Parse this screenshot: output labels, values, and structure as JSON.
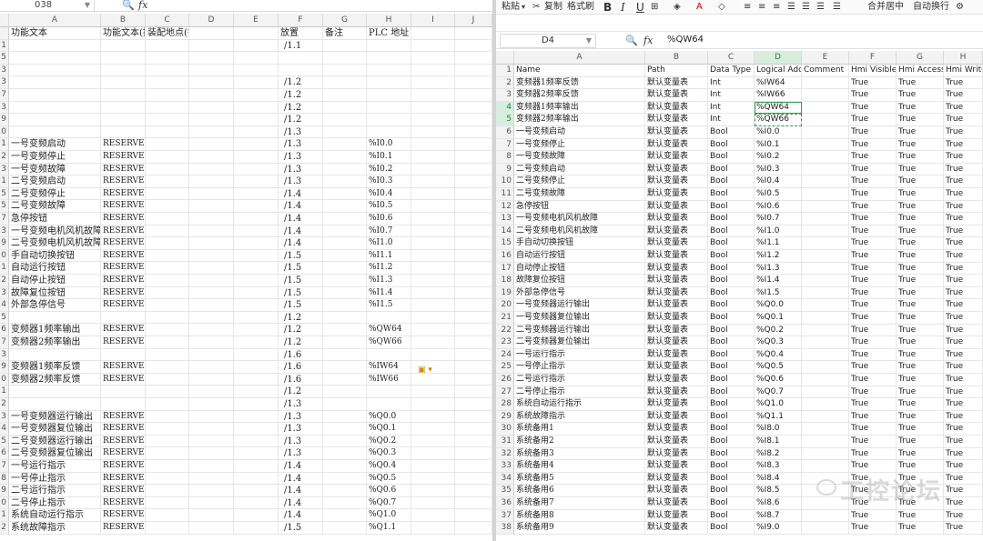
{
  "left": {
    "name_box": "038",
    "formula_icon": "fx",
    "zoom_icon": "magnifier-icon",
    "columns": [
      "A",
      "B",
      "C",
      "D",
      "E",
      "F",
      "G",
      "H",
      "I",
      "J"
    ],
    "header_row": [
      "功能文本",
      "功能文本(技术参数",
      "装配地点(铭牌文本",
      "",
      "",
      "放置",
      "备注",
      "PLC 地址",
      "",
      ""
    ],
    "rows": [
      {
        "num": "1",
        "a": "",
        "b": "",
        "f": "/1.1",
        "h": ""
      },
      {
        "num": "5",
        "a": "",
        "b": "",
        "f": "",
        "h": ""
      },
      {
        "num": "3",
        "a": "",
        "b": "",
        "f": "",
        "h": ""
      },
      {
        "num": "3",
        "a": "",
        "b": "",
        "f": "/1.2",
        "h": ""
      },
      {
        "num": "7",
        "a": "",
        "b": "",
        "f": "/1.2",
        "h": ""
      },
      {
        "num": "3",
        "a": "",
        "b": "",
        "f": "/1.2",
        "h": ""
      },
      {
        "num": "9",
        "a": "",
        "b": "",
        "f": "/1.2",
        "h": ""
      },
      {
        "num": "0",
        "a": "",
        "b": "",
        "f": "/1.3",
        "h": ""
      },
      {
        "num": "1",
        "a": "一号变频启动",
        "b": "RESERVE",
        "f": "/1.3",
        "h": "%I0.0"
      },
      {
        "num": "2",
        "a": "一号变频停止",
        "b": "RESERVE",
        "f": "/1.3",
        "h": "%I0.1"
      },
      {
        "num": "3",
        "a": "一号变频故障",
        "b": "RESERVE",
        "f": "/1.3",
        "h": "%I0.2"
      },
      {
        "num": "1",
        "a": "二号变频启动",
        "b": "RESERVE",
        "f": "/1.3",
        "h": "%I0.3"
      },
      {
        "num": "5",
        "a": "二号变频停止",
        "b": "RESERVE",
        "f": "/1.4",
        "h": "%I0.4"
      },
      {
        "num": "5",
        "a": "二号变频故障",
        "b": "RESERVE",
        "f": "/1.4",
        "h": "%I0.5"
      },
      {
        "num": "7",
        "a": "急停按钮",
        "b": "RESERVE",
        "f": "/1.4",
        "h": "%I0.6"
      },
      {
        "num": "3",
        "a": "一号变频电机风机故障",
        "b": "RESERVE",
        "f": "/1.4",
        "h": "%I0.7"
      },
      {
        "num": "9",
        "a": "二号变频电机风机故障",
        "b": "RESERVE",
        "f": "/1.4",
        "h": "%I1.0"
      },
      {
        "num": "0",
        "a": "手自动切换按钮",
        "b": "RESERVE",
        "f": "/1.5",
        "h": "%I1.1"
      },
      {
        "num": "1",
        "a": "自动运行按钮",
        "b": "RESERVE",
        "f": "/1.5",
        "h": "%I1.2"
      },
      {
        "num": "2",
        "a": "自动停止按钮",
        "b": "RESERVE",
        "f": "/1.5",
        "h": "%I1.3"
      },
      {
        "num": "3",
        "a": "故障复位按钮",
        "b": "RESERVE",
        "f": "/1.5",
        "h": "%I1.4"
      },
      {
        "num": "4",
        "a": "外部急停信号",
        "b": "RESERVE",
        "f": "/1.5",
        "h": "%I1.5"
      },
      {
        "num": "5",
        "a": "",
        "b": "",
        "f": "/1.2",
        "h": ""
      },
      {
        "num": "6",
        "a": "变频器1频率输出",
        "b": "RESERVE",
        "f": "/1.2",
        "h": "%QW64"
      },
      {
        "num": "7",
        "a": "变频器2频率输出",
        "b": "RESERVE",
        "f": "/1.2",
        "h": "%QW66"
      },
      {
        "num": "3",
        "a": "",
        "b": "",
        "f": "/1.6",
        "h": ""
      },
      {
        "num": "9",
        "a": "变频器1频率反馈",
        "b": "RESERVE",
        "f": "/1.6",
        "h": "%IW64"
      },
      {
        "num": "0",
        "a": "变频器2频率反馈",
        "b": "RESERVE",
        "f": "/1.6",
        "h": "%IW66"
      },
      {
        "num": "1",
        "a": "",
        "b": "",
        "f": "/1.2",
        "h": ""
      },
      {
        "num": "2",
        "a": "",
        "b": "",
        "f": "/1.3",
        "h": ""
      },
      {
        "num": "3",
        "a": "一号变频器运行输出",
        "b": "RESERVE",
        "f": "/1.3",
        "h": "%Q0.0"
      },
      {
        "num": "4",
        "a": "一号变频器复位输出",
        "b": "RESERVE",
        "f": "/1.3",
        "h": "%Q0.1"
      },
      {
        "num": "5",
        "a": "二号变频器运行输出",
        "b": "RESERVE",
        "f": "/1.3",
        "h": "%Q0.2"
      },
      {
        "num": "6",
        "a": "二号变频器复位输出",
        "b": "RESERVE",
        "f": "/1.3",
        "h": "%Q0.3"
      },
      {
        "num": "7",
        "a": "一号运行指示",
        "b": "RESERVE",
        "f": "/1.4",
        "h": "%Q0.4"
      },
      {
        "num": "8",
        "a": "一号停止指示",
        "b": "RESERVE",
        "f": "/1.4",
        "h": "%Q0.5"
      },
      {
        "num": "9",
        "a": "二号运行指示",
        "b": "RESERVE",
        "f": "/1.4",
        "h": "%Q0.6"
      },
      {
        "num": "0",
        "a": "二号停止指示",
        "b": "RESERVE",
        "f": "/1.4",
        "h": "%Q0.7"
      },
      {
        "num": "1",
        "a": "系统自动运行指示",
        "b": "RESERVE",
        "f": "/1.4",
        "h": "%Q1.0"
      },
      {
        "num": "2",
        "a": "系统故障指示",
        "b": "RESERVE",
        "f": "/1.5",
        "h": "%Q1.1"
      }
    ]
  },
  "right": {
    "toolbar": {
      "paste": "粘贴",
      "copy": "复制",
      "format_painter": "格式刷",
      "bold": "B",
      "italic": "I",
      "underline": "U",
      "merge_center": "合并居中",
      "wrap": "自动换行"
    },
    "name_box": "D4",
    "formula_icon": "fx",
    "formula_value": "%QW64",
    "columns": [
      "A",
      "B",
      "C",
      "D",
      "E",
      "F",
      "G",
      "H"
    ],
    "header": [
      "Name",
      "Path",
      "Data Type",
      "Logical Addr",
      "Comment",
      "Hmi Visible",
      "Hmi Accessi",
      "Hmi Write"
    ],
    "rows": [
      {
        "num": "2",
        "name": "变频器1频率反馈",
        "path": "默认变量表",
        "type": "Int",
        "addr": "%IW64",
        "vis": "True",
        "acc": "True",
        "wr": "True"
      },
      {
        "num": "3",
        "name": "变频器2频率反馈",
        "path": "默认变量表",
        "type": "Int",
        "addr": "%IW66",
        "vis": "True",
        "acc": "True",
        "wr": "True"
      },
      {
        "num": "4",
        "name": "变频器1频率输出",
        "path": "默认变量表",
        "type": "Int",
        "addr": "%QW64",
        "vis": "True",
        "acc": "True",
        "wr": "True"
      },
      {
        "num": "5",
        "name": "变频器2频率输出",
        "path": "默认变量表",
        "type": "Int",
        "addr": "%QW66",
        "vis": "True",
        "acc": "True",
        "wr": "True"
      },
      {
        "num": "6",
        "name": "一号变频启动",
        "path": "默认变量表",
        "type": "Bool",
        "addr": "%I0.0",
        "vis": "True",
        "acc": "True",
        "wr": "True"
      },
      {
        "num": "7",
        "name": "一号变频停止",
        "path": "默认变量表",
        "type": "Bool",
        "addr": "%I0.1",
        "vis": "True",
        "acc": "True",
        "wr": "True"
      },
      {
        "num": "8",
        "name": "一号变频故障",
        "path": "默认变量表",
        "type": "Bool",
        "addr": "%I0.2",
        "vis": "True",
        "acc": "True",
        "wr": "True"
      },
      {
        "num": "9",
        "name": "二号变频启动",
        "path": "默认变量表",
        "type": "Bool",
        "addr": "%I0.3",
        "vis": "True",
        "acc": "True",
        "wr": "True"
      },
      {
        "num": "10",
        "name": "二号变频停止",
        "path": "默认变量表",
        "type": "Bool",
        "addr": "%I0.4",
        "vis": "True",
        "acc": "True",
        "wr": "True"
      },
      {
        "num": "11",
        "name": "二号变频故障",
        "path": "默认变量表",
        "type": "Bool",
        "addr": "%I0.5",
        "vis": "True",
        "acc": "True",
        "wr": "True"
      },
      {
        "num": "12",
        "name": "急停按钮",
        "path": "默认变量表",
        "type": "Bool",
        "addr": "%I0.6",
        "vis": "True",
        "acc": "True",
        "wr": "True"
      },
      {
        "num": "13",
        "name": "一号变频电机风机故障",
        "path": "默认变量表",
        "type": "Bool",
        "addr": "%I0.7",
        "vis": "True",
        "acc": "True",
        "wr": "True"
      },
      {
        "num": "14",
        "name": "二号变频电机风机故障",
        "path": "默认变量表",
        "type": "Bool",
        "addr": "%I1.0",
        "vis": "True",
        "acc": "True",
        "wr": "True"
      },
      {
        "num": "15",
        "name": "手自动切换按钮",
        "path": "默认变量表",
        "type": "Bool",
        "addr": "%I1.1",
        "vis": "True",
        "acc": "True",
        "wr": "True"
      },
      {
        "num": "16",
        "name": "自动运行按钮",
        "path": "默认变量表",
        "type": "Bool",
        "addr": "%I1.2",
        "vis": "True",
        "acc": "True",
        "wr": "True"
      },
      {
        "num": "17",
        "name": "自动停止按钮",
        "path": "默认变量表",
        "type": "Bool",
        "addr": "%I1.3",
        "vis": "True",
        "acc": "True",
        "wr": "True"
      },
      {
        "num": "18",
        "name": "故障复位按钮",
        "path": "默认变量表",
        "type": "Bool",
        "addr": "%I1.4",
        "vis": "True",
        "acc": "True",
        "wr": "True"
      },
      {
        "num": "19",
        "name": "外部急停信号",
        "path": "默认变量表",
        "type": "Bool",
        "addr": "%I1.5",
        "vis": "True",
        "acc": "True",
        "wr": "True"
      },
      {
        "num": "20",
        "name": "一号变频器运行输出",
        "path": "默认变量表",
        "type": "Bool",
        "addr": "%Q0.0",
        "vis": "True",
        "acc": "True",
        "wr": "True"
      },
      {
        "num": "21",
        "name": "一号变频器复位输出",
        "path": "默认变量表",
        "type": "Bool",
        "addr": "%Q0.1",
        "vis": "True",
        "acc": "True",
        "wr": "True"
      },
      {
        "num": "22",
        "name": "二号变频器运行输出",
        "path": "默认变量表",
        "type": "Bool",
        "addr": "%Q0.2",
        "vis": "True",
        "acc": "True",
        "wr": "True"
      },
      {
        "num": "23",
        "name": "二号变频器复位输出",
        "path": "默认变量表",
        "type": "Bool",
        "addr": "%Q0.3",
        "vis": "True",
        "acc": "True",
        "wr": "True"
      },
      {
        "num": "24",
        "name": "一号运行指示",
        "path": "默认变量表",
        "type": "Bool",
        "addr": "%Q0.4",
        "vis": "True",
        "acc": "True",
        "wr": "True"
      },
      {
        "num": "25",
        "name": "一号停止指示",
        "path": "默认变量表",
        "type": "Bool",
        "addr": "%Q0.5",
        "vis": "True",
        "acc": "True",
        "wr": "True"
      },
      {
        "num": "26",
        "name": "二号运行指示",
        "path": "默认变量表",
        "type": "Bool",
        "addr": "%Q0.6",
        "vis": "True",
        "acc": "True",
        "wr": "True"
      },
      {
        "num": "27",
        "name": "二号停止指示",
        "path": "默认变量表",
        "type": "Bool",
        "addr": "%Q0.7",
        "vis": "True",
        "acc": "True",
        "wr": "True"
      },
      {
        "num": "28",
        "name": "系统自动运行指示",
        "path": "默认变量表",
        "type": "Bool",
        "addr": "%Q1.0",
        "vis": "True",
        "acc": "True",
        "wr": "True"
      },
      {
        "num": "29",
        "name": "系统故障指示",
        "path": "默认变量表",
        "type": "Bool",
        "addr": "%Q1.1",
        "vis": "True",
        "acc": "True",
        "wr": "True"
      },
      {
        "num": "30",
        "name": "系统备用1",
        "path": "默认变量表",
        "type": "Bool",
        "addr": "%I8.0",
        "vis": "True",
        "acc": "True",
        "wr": "True"
      },
      {
        "num": "31",
        "name": "系统备用2",
        "path": "默认变量表",
        "type": "Bool",
        "addr": "%I8.1",
        "vis": "True",
        "acc": "True",
        "wr": "True"
      },
      {
        "num": "32",
        "name": "系统备用3",
        "path": "默认变量表",
        "type": "Bool",
        "addr": "%I8.2",
        "vis": "True",
        "acc": "True",
        "wr": "True"
      },
      {
        "num": "33",
        "name": "系统备用4",
        "path": "默认变量表",
        "type": "Bool",
        "addr": "%I8.3",
        "vis": "True",
        "acc": "True",
        "wr": "True"
      },
      {
        "num": "34",
        "name": "系统备用5",
        "path": "默认变量表",
        "type": "Bool",
        "addr": "%I8.4",
        "vis": "True",
        "acc": "True",
        "wr": "True"
      },
      {
        "num": "35",
        "name": "系统备用6",
        "path": "默认变量表",
        "type": "Bool",
        "addr": "%I8.5",
        "vis": "True",
        "acc": "True",
        "wr": "True"
      },
      {
        "num": "36",
        "name": "系统备用7",
        "path": "默认变量表",
        "type": "Bool",
        "addr": "%I8.6",
        "vis": "True",
        "acc": "True",
        "wr": "True"
      },
      {
        "num": "37",
        "name": "系统备用8",
        "path": "默认变量表",
        "type": "Bool",
        "addr": "%I8.7",
        "vis": "True",
        "acc": "True",
        "wr": "True"
      },
      {
        "num": "38",
        "name": "系统备用9",
        "path": "默认变量表",
        "type": "Bool",
        "addr": "%I9.0",
        "vis": "True",
        "acc": "True",
        "wr": "True"
      }
    ]
  },
  "watermark": "工控论坛",
  "colors": {
    "selection": "#2f9d57",
    "header_bg": "#f3f3f3"
  }
}
